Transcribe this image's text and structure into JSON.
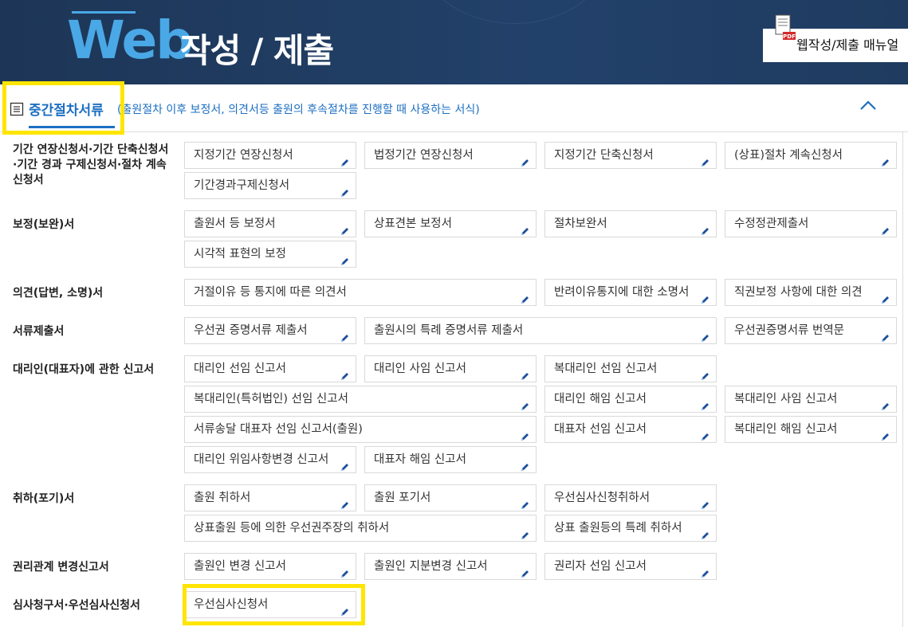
{
  "header": {
    "title_web": "Web",
    "title_rest": "작성 / 제출",
    "manual_button": "웹작성/제출 매뉴얼",
    "pdf_icon_label": "PDF"
  },
  "section": {
    "title": "중간절차서류",
    "description": "(출원절차 이후 보정서, 의견서등 출원의 후속절차를 진행할 때 사용하는 서식)",
    "collapse_icon": "chevron-up-icon"
  },
  "rows": [
    {
      "label": "기간 연장신청서·기간 단축신청서·기간 경과 구제신청서·절차 계속신청서",
      "label_lines": [
        "기간 연장신청서·기간 단축신청서",
        "·기간 경과 구제신청서·절차 계속",
        "신청서"
      ],
      "items": [
        "지정기간 연장신청서",
        "법정기간 연장신청서",
        "지정기간 단축신청서",
        "(상표)절차 계속신청서",
        "기간경과구제신청서"
      ]
    },
    {
      "label": "보정(보완)서",
      "items": [
        "출원서 등 보정서",
        "상표견본 보정서",
        "절차보완서",
        "수정정관제출서",
        "시각적 표현의 보정"
      ]
    },
    {
      "label": "의견(답변, 소명)서",
      "items": [
        "거절이유 등 통지에 따른 의견서",
        "반려이유통지에 대한 소명서",
        "직권보정 사항에 대한 의견"
      ]
    },
    {
      "label": "서류제출서",
      "items": [
        "우선권 증명서류 제출서",
        "출원시의 특례 증명서류 제출서",
        "우선권증명서류 번역문"
      ]
    },
    {
      "label": "대리인(대표자)에 관한 신고서",
      "items": [
        "대리인 선임 신고서",
        "대리인 사임 신고서",
        "복대리인 선임 신고서",
        "복대리인(특허법인) 선임 신고서",
        "대리인 해임 신고서",
        "복대리인 사임 신고서",
        "서류송달 대표자 선임 신고서(출원)",
        "대표자 선임 신고서",
        "복대리인 해임 신고서",
        "대리인 위임사항변경 신고서",
        "대표자 해임 신고서"
      ]
    },
    {
      "label": "취하(포기)서",
      "items": [
        "출원 취하서",
        "출원 포기서",
        "우선심사신청취하서",
        "상표출원 등에 의한 우선권주장의 취하서",
        "상표 출원등의 특례 취하서"
      ]
    },
    {
      "label": "권리관계 변경신고서",
      "items": [
        "출원인 변경 신고서",
        "출원인 지분변경 신고서",
        "권리자 선임 신고서"
      ]
    },
    {
      "label": "심사청구서·우선심사신청서",
      "items": [
        "우선심사신청서"
      ]
    }
  ],
  "colors": {
    "banner_bg": "#1f3b60",
    "accent_blue": "#4aa8e6",
    "section_blue": "#1d6fc2",
    "highlight_yellow": "#ffe500"
  }
}
